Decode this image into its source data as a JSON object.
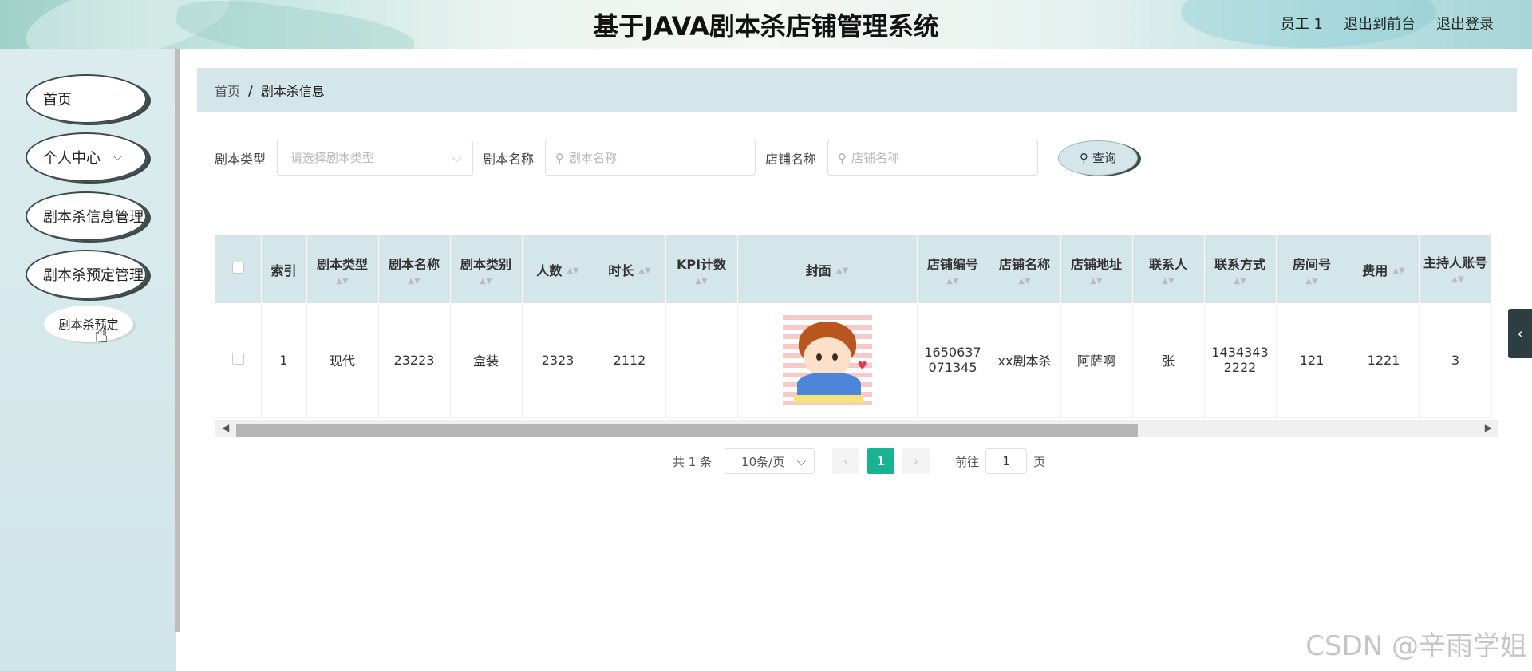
{
  "header": {
    "title": "基于JAVA剧本杀店铺管理系统",
    "user": "员工 1",
    "to_front": "退出到前台",
    "logout": "退出登录"
  },
  "sidebar": {
    "items": [
      {
        "label": "首页"
      },
      {
        "label": "个人中心"
      },
      {
        "label": "剧本杀信息管理"
      },
      {
        "label": "剧本杀预定管理"
      }
    ],
    "submenu": {
      "label": "剧本杀预定"
    }
  },
  "breadcrumb": {
    "home": "首页",
    "separator": "/",
    "current": "剧本杀信息"
  },
  "search": {
    "type_label": "剧本类型",
    "type_placeholder": "请选择剧本类型",
    "name_label": "剧本名称",
    "name_placeholder": "剧本名称",
    "shop_label": "店铺名称",
    "shop_placeholder": "店铺名称",
    "query_button": "查询"
  },
  "table": {
    "headers": {
      "index": "索引",
      "type": "剧本类型",
      "name": "剧本名称",
      "category": "剧本类别",
      "people": "人数",
      "duration": "时长",
      "kpi": "KPI计数",
      "cover": "封面",
      "shop_no": "店铺编号",
      "shop_name": "店铺名称",
      "shop_addr": "店铺地址",
      "contact": "联系人",
      "phone": "联系方式",
      "room": "房间号",
      "fee": "费用",
      "host": "主持人账号"
    },
    "rows": [
      {
        "index": "1",
        "type": "现代",
        "name": "23223",
        "category": "盒装",
        "people": "2323",
        "duration": "2112",
        "kpi": "",
        "shop_no": "1650637071345",
        "shop_name": "xx剧本杀",
        "shop_addr": "阿萨啊",
        "contact": "张",
        "phone": "14343432222",
        "room": "121",
        "fee": "1221",
        "host": "3"
      }
    ]
  },
  "pagination": {
    "total": "共 1 条",
    "page_size": "10条/页",
    "current_page": "1",
    "goto_label": "前往",
    "goto_value": "1",
    "page_unit": "页"
  },
  "watermark": "CSDN @辛雨学姐",
  "colors": {
    "accent": "#19b394",
    "header_bg": "#d5e6ea",
    "sidebar_bg": "#d4e8eb"
  }
}
